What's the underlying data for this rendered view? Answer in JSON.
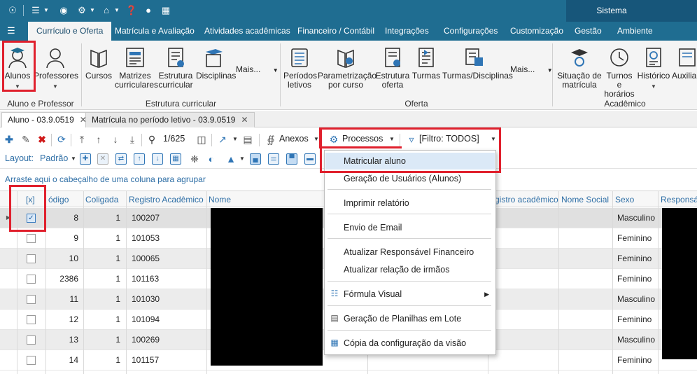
{
  "title_bar": {
    "system_label": "Sistema"
  },
  "ribbon_tabs": [
    {
      "label": "Currículo e Oferta",
      "active": true
    },
    {
      "label": "Matrícula e Avaliação"
    },
    {
      "label": "Atividades acadêmicas"
    },
    {
      "label": "Financeiro / Contábil"
    },
    {
      "label": "Integrações"
    },
    {
      "label": "Configurações"
    },
    {
      "label": "Customização"
    },
    {
      "label": "Gestão"
    },
    {
      "label": "Ambiente"
    }
  ],
  "ribbon": {
    "aluno_professor": {
      "label": "Aluno e Professor",
      "alunos": "Alunos",
      "professores": "Professores"
    },
    "estrutura_curricular": {
      "label": "Estrutura curricular",
      "cursos": "Cursos",
      "matrizes": [
        "Matrizes",
        "curriculares"
      ],
      "estrutura": [
        "Estrutura",
        "curricular"
      ],
      "disciplinas": "Disciplinas",
      "more": "Mais..."
    },
    "oferta": {
      "label": "Oferta",
      "periodos": [
        "Períodos",
        "letivos"
      ],
      "parametrizacao": [
        "Parametrização",
        "por curso"
      ],
      "estrutura_oferta": [
        "Estrutura",
        "oferta"
      ],
      "turmas": "Turmas",
      "turmas_disciplinas": "Turmas/Disciplinas",
      "more": "Mais..."
    },
    "academico": {
      "label": "Acadêmico",
      "situacao": [
        "Situação de",
        "matrícula"
      ],
      "turnos": [
        "Turnos e",
        "horários"
      ],
      "historico": "Histórico",
      "auxiliar": "Auxiliar"
    }
  },
  "doc_tabs": [
    {
      "label": "Aluno - 03.9.0519",
      "active": true
    },
    {
      "label": "Matrícula no período letivo - 03.9.0519"
    }
  ],
  "toolbar": {
    "record_position": "1/625",
    "anexos": "Anexos",
    "processos": "Processos",
    "filter": "[Filtro: TODOS]",
    "layout_label": "Layout:",
    "layout_value": "Padrão"
  },
  "groupby_text": "Arraste aqui o cabeçalho de uma coluna para agrupar",
  "grid": {
    "columns": [
      "[x]",
      "ódigo",
      "Coligada",
      "Registro Acadêmico",
      "Nome",
      "gistro acadêmico",
      "Nome Social",
      "Sexo",
      "Responsáv"
    ],
    "rows": [
      {
        "checked": true,
        "codigo": "8",
        "coligada": "1",
        "registro": "100207",
        "sexo": "Masculino"
      },
      {
        "checked": false,
        "codigo": "9",
        "coligada": "1",
        "registro": "101053",
        "sexo": "Feminino"
      },
      {
        "checked": false,
        "codigo": "10",
        "coligada": "1",
        "registro": "100065",
        "sexo": "Feminino"
      },
      {
        "checked": false,
        "codigo": "2386",
        "coligada": "1",
        "registro": "101163",
        "sexo": "Feminino"
      },
      {
        "checked": false,
        "codigo": "11",
        "coligada": "1",
        "registro": "101030",
        "sexo": "Masculino"
      },
      {
        "checked": false,
        "codigo": "12",
        "coligada": "1",
        "registro": "101094",
        "sexo": "Feminino"
      },
      {
        "checked": false,
        "codigo": "13",
        "coligada": "1",
        "registro": "100269",
        "sexo": "Masculino"
      },
      {
        "checked": false,
        "codigo": "14",
        "coligada": "1",
        "registro": "101157",
        "sexo": "Feminino"
      }
    ]
  },
  "processos_menu": [
    {
      "label": "Matricular aluno",
      "hover": true
    },
    {
      "label": "Geração de Usuários (Alunos)"
    },
    {
      "label": "Imprimir relatório"
    },
    {
      "label": "Envio de Email"
    },
    {
      "label": "Atualizar Responsável Financeiro"
    },
    {
      "label": "Atualizar relação de irmãos"
    },
    {
      "label": "Fórmula Visual",
      "submenu": true
    },
    {
      "label": "Geração de Planilhas em Lote"
    },
    {
      "label": "Cópia da configuração da visão"
    }
  ],
  "colors": {
    "titlebar": "#1f6d91",
    "accent": "#2f75b5",
    "highlight": "#e0202d"
  }
}
